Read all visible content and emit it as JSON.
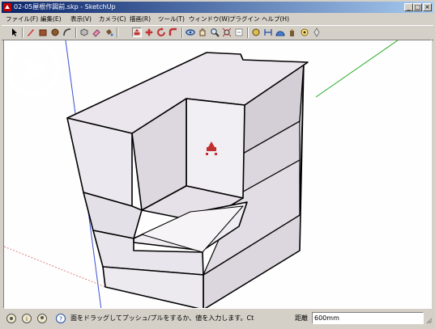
{
  "window": {
    "title": "02-05屋根作図前.skp - SketchUp",
    "controls": {
      "minimize": "_",
      "maximize": "□",
      "close": "×"
    }
  },
  "menu": [
    {
      "label": "ファイル(F)"
    },
    {
      "label": "編集(E)"
    },
    {
      "label": "表示(V)"
    },
    {
      "label": "カメラ(C)"
    },
    {
      "label": "描画(R)"
    },
    {
      "label": "ツール(T)"
    },
    {
      "label": "ウィンドウ(W)"
    },
    {
      "label": "プラグイン"
    },
    {
      "label": "ヘルプ(H)"
    }
  ],
  "toolbar": {
    "tools": [
      {
        "icon": "select-arrow-icon"
      },
      {
        "icon": "pencil-line-icon"
      },
      {
        "icon": "rectangle-icon"
      },
      {
        "icon": "circle-icon"
      },
      {
        "icon": "arc-icon"
      },
      {
        "icon": "make-component-icon"
      },
      {
        "icon": "eraser-icon"
      },
      {
        "icon": "paint-bucket-icon"
      },
      {
        "icon": "push-pull-icon",
        "active": true
      },
      {
        "icon": "move-icon"
      },
      {
        "icon": "rotate-icon"
      },
      {
        "icon": "follow-me-icon"
      },
      {
        "icon": "orbit-icon"
      },
      {
        "icon": "pan-icon"
      },
      {
        "icon": "zoom-icon"
      },
      {
        "icon": "zoom-extents-icon"
      },
      {
        "icon": "previous-view-icon"
      },
      {
        "icon": "tape-measure-icon"
      },
      {
        "icon": "dimension-icon"
      },
      {
        "icon": "protractor-icon"
      },
      {
        "icon": "walk-icon"
      },
      {
        "icon": "look-around-icon"
      },
      {
        "icon": "position-camera-icon"
      }
    ]
  },
  "statusbar": {
    "hint": "面をドラッグしてプッシュ/プルをするか、値を入力します。Ct",
    "measure_label": "距離",
    "measure_value": "600mm"
  },
  "colors": {
    "title_start": "#0a246a",
    "title_end": "#a6caf0",
    "chrome": "#d4d0c8",
    "axis_red": "#d22e2e",
    "axis_green": "#22aa22",
    "axis_blue": "#3a4fd0"
  }
}
